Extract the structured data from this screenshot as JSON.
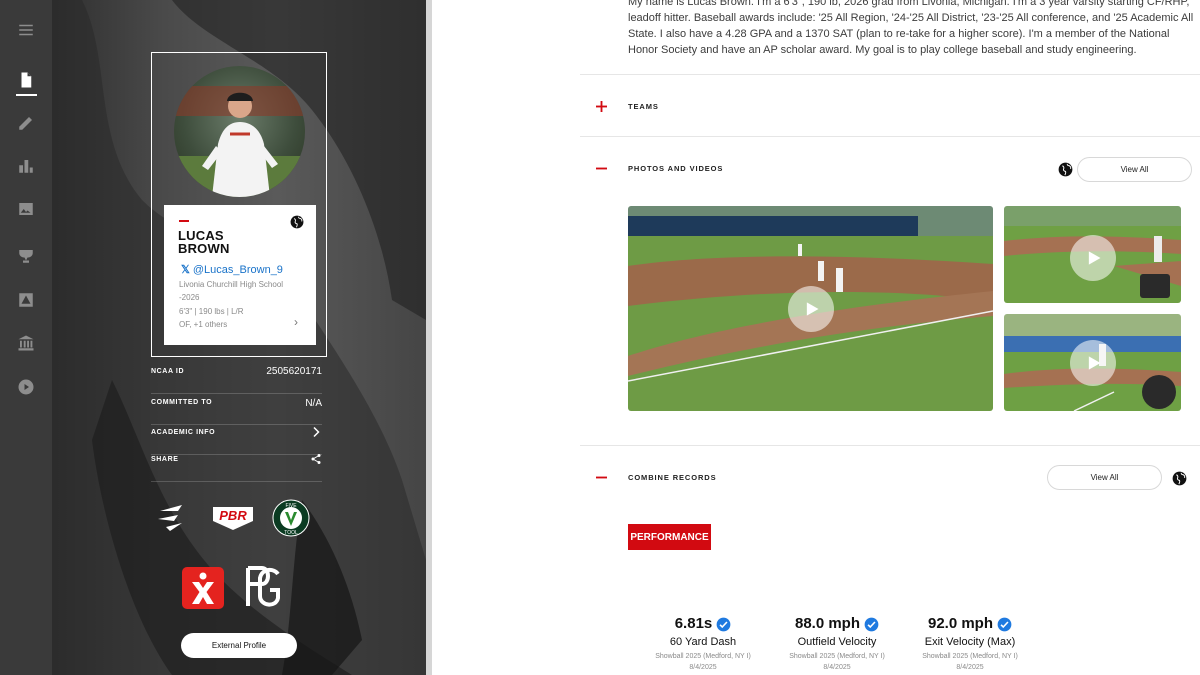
{
  "nav": {
    "items": [
      {
        "name": "menu",
        "icon": "hamburger-icon"
      },
      {
        "name": "profile",
        "icon": "document-icon",
        "active": true
      },
      {
        "name": "edit",
        "icon": "pencil-icon"
      },
      {
        "name": "stats",
        "icon": "bar-chart-icon"
      },
      {
        "name": "media",
        "icon": "image-icon"
      },
      {
        "name": "awards",
        "icon": "trophy-icon"
      },
      {
        "name": "showcase",
        "icon": "alert-icon"
      },
      {
        "name": "college",
        "icon": "bank-icon"
      },
      {
        "name": "video",
        "icon": "play-circle-icon"
      }
    ]
  },
  "profile": {
    "name": "LUCAS\nBROWN",
    "twitter": "@Lucas_Brown_9",
    "school": "Livonia Churchill High School -2026",
    "physical": "6'3\" | 190 lbs | L/R",
    "positions": "OF, +1 others",
    "rows": [
      {
        "label": "NCAA ID",
        "value": "2505620171"
      },
      {
        "label": "COMMITTED TO",
        "value": "N/A"
      },
      {
        "label": "ACADEMIC INFO",
        "value": ""
      },
      {
        "label": "SHARE",
        "value": ""
      }
    ],
    "external_profile": "External Profile",
    "logos": [
      "fl-logo",
      "pbr-logo",
      "five-tool-logo",
      "x-logo",
      "pg-logo"
    ],
    "logo_texts": {
      "pbr": "PBR",
      "five": "FIVE",
      "tool": "TOOL"
    }
  },
  "bio": "My name is Lucas Brown. I'm a 6'3\", 190 lb, 2026 grad from Livonia, Michigan. I'm a 3 year varsity starting CF/RHP, leadoff hitter. Baseball awards include: '25 All Region, '24-'25 All District, '23-'25 All conference, and '25 Academic All State. I also have a 4.28 GPA and a 1370 SAT (plan to re-take for a higher score). I'm a member of the National Honor Society and have an AP scholar award. My goal is to play college baseball and study engineering.",
  "sections": {
    "teams": {
      "title": "TEAMS"
    },
    "photos": {
      "title": "PHOTOS AND VIDEOS",
      "view_all": "View All"
    },
    "combine": {
      "title": "COMBINE RECORDS",
      "view_all": "View All",
      "filter": "PERFORMANCE"
    }
  },
  "combine_stats": [
    {
      "value": "6.81s",
      "name": "60 Yard Dash",
      "event": "Showball 2025 (Medford, NY I)",
      "date": "8/4/2025"
    },
    {
      "value": "88.0 mph",
      "name": "Outfield Velocity",
      "event": "Showball 2025 (Medford, NY I)",
      "date": "8/4/2025"
    },
    {
      "value": "92.0 mph",
      "name": "Exit Velocity (Max)",
      "event": "Showball 2025 (Medford, NY I)",
      "date": "8/4/2025"
    }
  ],
  "colors": {
    "accent": "#d20a11",
    "link": "#1a73c9",
    "verified": "#1f7ae0"
  }
}
